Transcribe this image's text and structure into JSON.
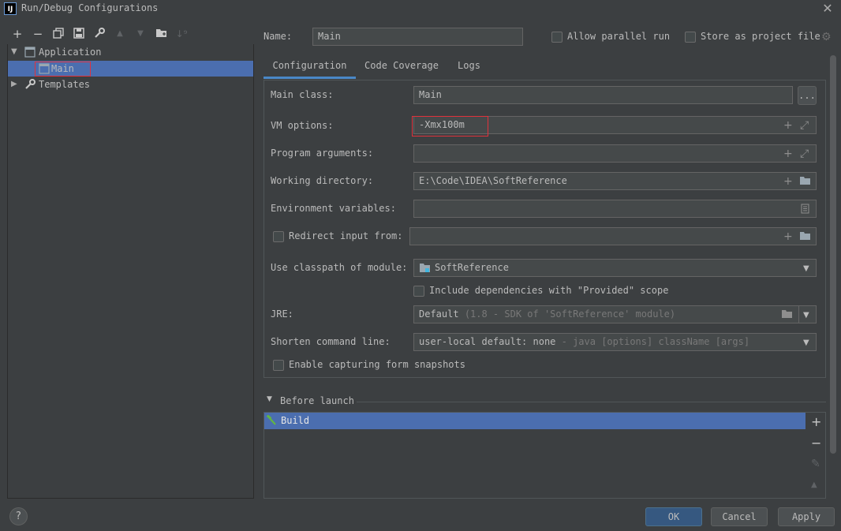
{
  "window": {
    "title": "Run/Debug Configurations",
    "logo": "IJ",
    "close_icon": "close-icon"
  },
  "toolbar": {
    "items": [
      {
        "name": "add",
        "glyph": "+"
      },
      {
        "name": "remove",
        "glyph": "−"
      },
      {
        "name": "copy",
        "glyph": "⧉"
      },
      {
        "name": "save",
        "glyph": "▣"
      },
      {
        "name": "edit-defaults",
        "glyph": "🔧"
      },
      {
        "name": "move-up",
        "glyph": "▲"
      },
      {
        "name": "move-down",
        "glyph": "▼"
      },
      {
        "name": "new-folder",
        "glyph": "▰"
      },
      {
        "name": "sort",
        "glyph": "⇅"
      }
    ]
  },
  "tree": {
    "application": "Application",
    "main": "Main",
    "templates": "Templates"
  },
  "name_row": {
    "label": "Name:",
    "value": "Main",
    "allow_parallel": "Allow parallel run",
    "store_as_file": "Store as project file"
  },
  "tabs": [
    "Configuration",
    "Code Coverage",
    "Logs"
  ],
  "form": {
    "main_class_label": "Main class:",
    "main_class_value": "Main",
    "browse": "...",
    "vm_options_label": "VM options:",
    "vm_options_value": "-Xmx100m",
    "program_args_label": "Program arguments:",
    "working_dir_label": "Working directory:",
    "working_dir_value": "E:\\Code\\IDEA\\SoftReference",
    "env_vars_label": "Environment variables:",
    "redirect_label": "Redirect input from:",
    "classpath_label": "Use classpath of module:",
    "classpath_value": "SoftReference",
    "include_deps": "Include dependencies with \"Provided\" scope",
    "jre_label": "JRE:",
    "jre_value": "Default",
    "jre_hint": "(1.8 - SDK of 'SoftReference' module)",
    "shorten_label": "Shorten command line:",
    "shorten_value": "user-local default: none",
    "shorten_hint": "- java [options] className [args]",
    "capture_label": "Enable capturing form snapshots"
  },
  "before_launch": {
    "title": "Before launch",
    "items": [
      "Build"
    ]
  },
  "buttons": {
    "ok": "OK",
    "cancel": "Cancel",
    "apply": "Apply",
    "help": "?"
  },
  "colors": {
    "background": "#3c3f41",
    "selection": "#4b6eaf",
    "accent": "#4a88c7",
    "highlight_box": "#e0323c"
  }
}
